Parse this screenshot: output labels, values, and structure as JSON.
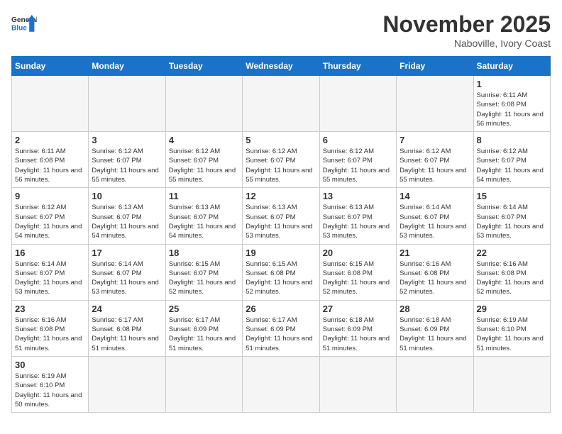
{
  "header": {
    "logo_general": "General",
    "logo_blue": "Blue",
    "month_title": "November 2025",
    "location": "Naboville, Ivory Coast"
  },
  "weekdays": [
    "Sunday",
    "Monday",
    "Tuesday",
    "Wednesday",
    "Thursday",
    "Friday",
    "Saturday"
  ],
  "days": {
    "d1": {
      "num": "1",
      "sunrise": "6:11 AM",
      "sunset": "6:08 PM",
      "daylight": "11 hours and 56 minutes."
    },
    "d2": {
      "num": "2",
      "sunrise": "6:11 AM",
      "sunset": "6:08 PM",
      "daylight": "11 hours and 56 minutes."
    },
    "d3": {
      "num": "3",
      "sunrise": "6:12 AM",
      "sunset": "6:07 PM",
      "daylight": "11 hours and 55 minutes."
    },
    "d4": {
      "num": "4",
      "sunrise": "6:12 AM",
      "sunset": "6:07 PM",
      "daylight": "11 hours and 55 minutes."
    },
    "d5": {
      "num": "5",
      "sunrise": "6:12 AM",
      "sunset": "6:07 PM",
      "daylight": "11 hours and 55 minutes."
    },
    "d6": {
      "num": "6",
      "sunrise": "6:12 AM",
      "sunset": "6:07 PM",
      "daylight": "11 hours and 55 minutes."
    },
    "d7": {
      "num": "7",
      "sunrise": "6:12 AM",
      "sunset": "6:07 PM",
      "daylight": "11 hours and 55 minutes."
    },
    "d8": {
      "num": "8",
      "sunrise": "6:12 AM",
      "sunset": "6:07 PM",
      "daylight": "11 hours and 54 minutes."
    },
    "d9": {
      "num": "9",
      "sunrise": "6:12 AM",
      "sunset": "6:07 PM",
      "daylight": "11 hours and 54 minutes."
    },
    "d10": {
      "num": "10",
      "sunrise": "6:13 AM",
      "sunset": "6:07 PM",
      "daylight": "11 hours and 54 minutes."
    },
    "d11": {
      "num": "11",
      "sunrise": "6:13 AM",
      "sunset": "6:07 PM",
      "daylight": "11 hours and 54 minutes."
    },
    "d12": {
      "num": "12",
      "sunrise": "6:13 AM",
      "sunset": "6:07 PM",
      "daylight": "11 hours and 53 minutes."
    },
    "d13": {
      "num": "13",
      "sunrise": "6:13 AM",
      "sunset": "6:07 PM",
      "daylight": "11 hours and 53 minutes."
    },
    "d14": {
      "num": "14",
      "sunrise": "6:14 AM",
      "sunset": "6:07 PM",
      "daylight": "11 hours and 53 minutes."
    },
    "d15": {
      "num": "15",
      "sunrise": "6:14 AM",
      "sunset": "6:07 PM",
      "daylight": "11 hours and 53 minutes."
    },
    "d16": {
      "num": "16",
      "sunrise": "6:14 AM",
      "sunset": "6:07 PM",
      "daylight": "11 hours and 53 minutes."
    },
    "d17": {
      "num": "17",
      "sunrise": "6:14 AM",
      "sunset": "6:07 PM",
      "daylight": "11 hours and 53 minutes."
    },
    "d18": {
      "num": "18",
      "sunrise": "6:15 AM",
      "sunset": "6:07 PM",
      "daylight": "11 hours and 52 minutes."
    },
    "d19": {
      "num": "19",
      "sunrise": "6:15 AM",
      "sunset": "6:08 PM",
      "daylight": "11 hours and 52 minutes."
    },
    "d20": {
      "num": "20",
      "sunrise": "6:15 AM",
      "sunset": "6:08 PM",
      "daylight": "11 hours and 52 minutes."
    },
    "d21": {
      "num": "21",
      "sunrise": "6:16 AM",
      "sunset": "6:08 PM",
      "daylight": "11 hours and 52 minutes."
    },
    "d22": {
      "num": "22",
      "sunrise": "6:16 AM",
      "sunset": "6:08 PM",
      "daylight": "11 hours and 52 minutes."
    },
    "d23": {
      "num": "23",
      "sunrise": "6:16 AM",
      "sunset": "6:08 PM",
      "daylight": "11 hours and 51 minutes."
    },
    "d24": {
      "num": "24",
      "sunrise": "6:17 AM",
      "sunset": "6:08 PM",
      "daylight": "11 hours and 51 minutes."
    },
    "d25": {
      "num": "25",
      "sunrise": "6:17 AM",
      "sunset": "6:09 PM",
      "daylight": "11 hours and 51 minutes."
    },
    "d26": {
      "num": "26",
      "sunrise": "6:17 AM",
      "sunset": "6:09 PM",
      "daylight": "11 hours and 51 minutes."
    },
    "d27": {
      "num": "27",
      "sunrise": "6:18 AM",
      "sunset": "6:09 PM",
      "daylight": "11 hours and 51 minutes."
    },
    "d28": {
      "num": "28",
      "sunrise": "6:18 AM",
      "sunset": "6:09 PM",
      "daylight": "11 hours and 51 minutes."
    },
    "d29": {
      "num": "29",
      "sunrise": "6:19 AM",
      "sunset": "6:10 PM",
      "daylight": "11 hours and 51 minutes."
    },
    "d30": {
      "num": "30",
      "sunrise": "6:19 AM",
      "sunset": "6:10 PM",
      "daylight": "11 hours and 50 minutes."
    }
  },
  "labels": {
    "sunrise": "Sunrise:",
    "sunset": "Sunset:",
    "daylight": "Daylight:"
  },
  "colors": {
    "header_bg": "#1a73c8"
  }
}
